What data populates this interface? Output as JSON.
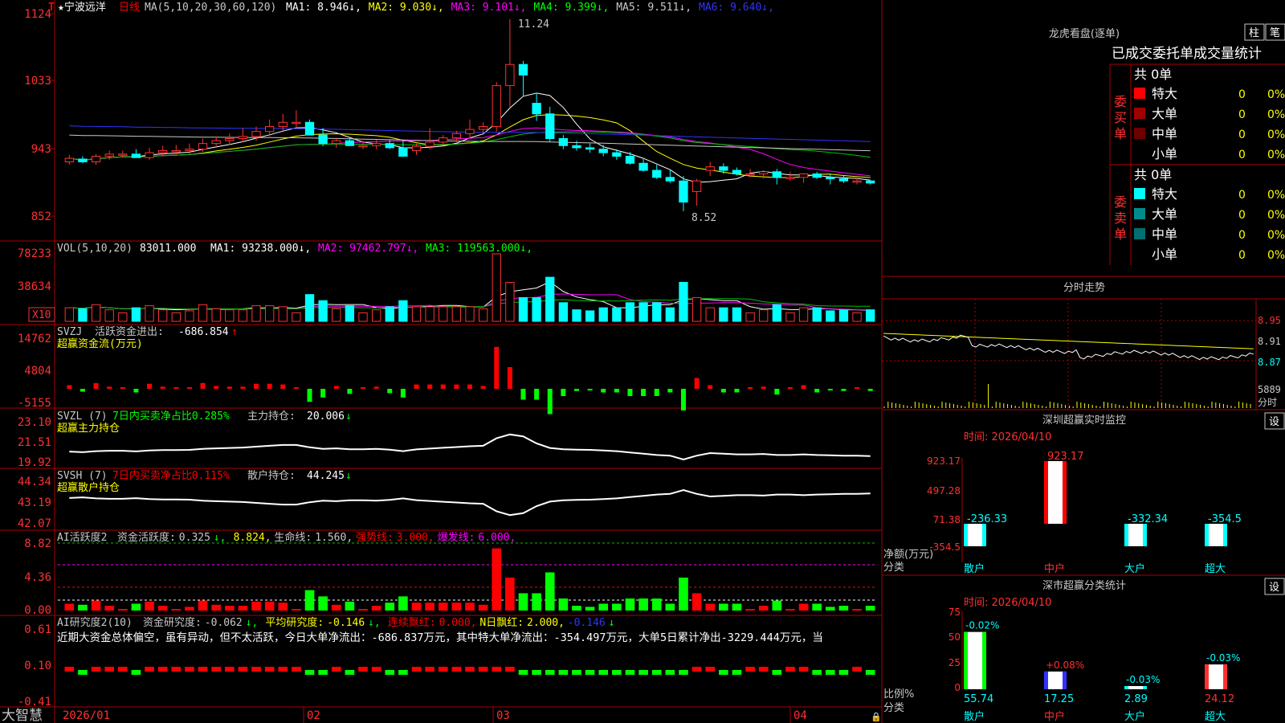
{
  "header": {
    "stock_name": "★宁波远洋",
    "period": "日线",
    "ma_label": "MA(5,10,20,30,60,120)",
    "ma_values": [
      {
        "label": "MA1:",
        "value": "8.946",
        "arrow": "↓",
        "color": "#ffffff"
      },
      {
        "label": "MA2:",
        "value": "9.030",
        "arrow": "↓",
        "color": "#ffff00"
      },
      {
        "label": "MA3:",
        "value": "9.101",
        "arrow": "↓",
        "color": "#ff00ff"
      },
      {
        "label": "MA4:",
        "value": "9.399",
        "arrow": "↓",
        "color": "#00ff00"
      },
      {
        "label": "MA5:",
        "value": "9.511",
        "arrow": "↓",
        "color": "#c8c8c8"
      },
      {
        "label": "MA6:",
        "value": "9.640",
        "arrow": "↓",
        "color": "#3232ff"
      }
    ],
    "high_marker": "11.24",
    "low_marker": "8.52",
    "top_marker": "T"
  },
  "price_axis": [
    "1124",
    "1033",
    "943",
    "852"
  ],
  "vol_panel": {
    "title": "VOL(5,10,20)",
    "value": "83011.000",
    "items": [
      {
        "label": "MA1:",
        "value": "93238.000",
        "arrow": "↓",
        "color": "#ffffff"
      },
      {
        "label": "MA2:",
        "value": "97462.797",
        "arrow": "↓",
        "color": "#ff00ff"
      },
      {
        "label": "MA3:",
        "value": "119563.000",
        "arrow": "↓",
        "color": "#00ff00"
      }
    ],
    "axis": [
      "78233",
      "38634"
    ],
    "unit_badge": "X10"
  },
  "svzj_panel": {
    "title": "SVZJ",
    "label": "活跃资金进出:",
    "value": "-686.854",
    "arrow": "↑",
    "subtitle": "超赢资金流(万元)",
    "axis": [
      "14762",
      "4804",
      "-5155"
    ]
  },
  "svzl_panel": {
    "title": "SVZL (7)",
    "label": "7日内买卖净占比0.285%",
    "label2": "主力持仓:",
    "value": "20.006",
    "arrow": "↓",
    "subtitle": "超赢主力持仓",
    "axis": [
      "23.10",
      "21.51",
      "19.92"
    ]
  },
  "svsh_panel": {
    "title": "SVSH (7)",
    "label": "7日内买卖净占比0.115%",
    "label2": "散户持仓:",
    "value": "44.245",
    "arrow": "↓",
    "subtitle": "超赢散户持仓",
    "axis": [
      "44.34",
      "43.19",
      "42.07"
    ]
  },
  "ai_active_panel": {
    "title": "AI活跃度2",
    "items": [
      {
        "text": "资金活跃度:",
        "color": "#c8c8c8"
      },
      {
        "text": "0.325",
        "color": "#c8c8c8"
      },
      {
        "text": "↓,",
        "color": "#00ff00"
      },
      {
        "text": "8.824,",
        "color": "#ffff00"
      },
      {
        "text": "生命线:",
        "color": "#c8c8c8"
      },
      {
        "text": "1.560,",
        "color": "#c8c8c8"
      },
      {
        "text": "强势线:",
        "color": "#ff0000"
      },
      {
        "text": "3.000,",
        "color": "#ff0000"
      },
      {
        "text": "爆发线:",
        "color": "#ff00ff"
      },
      {
        "text": "6.000,",
        "color": "#ff00ff"
      }
    ],
    "axis": [
      "8.82",
      "4.36",
      "0.00"
    ]
  },
  "ai_research_panel": {
    "title": "AI研究度2(10)",
    "items": [
      {
        "text": "资金研究度:",
        "color": "#c8c8c8"
      },
      {
        "text": "-0.062",
        "color": "#c8c8c8"
      },
      {
        "text": "↓,",
        "color": "#00ff00"
      },
      {
        "text": "平均研究度:",
        "color": "#ffff00"
      },
      {
        "text": "-0.146",
        "color": "#ffff00"
      },
      {
        "text": "↓,",
        "color": "#00ff00"
      },
      {
        "text": "连续飘红:",
        "color": "#ff0000"
      },
      {
        "text": "0.000,",
        "color": "#ff0000"
      },
      {
        "text": "N日飘红:",
        "color": "#ffff00"
      },
      {
        "text": "2.000,",
        "color": "#ffff00"
      },
      {
        "text": "-0.146",
        "color": "#3232ff"
      },
      {
        "text": "↓",
        "color": "#00ff00"
      }
    ],
    "summary": "近期大资金总体偏空，虽有异动，但不太活跃，今日大单净流出：-686.837万元，其中特大单净流出：-354.497万元，大单5日累计净出-3229.444万元，当",
    "axis": [
      "0.61",
      "0.10",
      "-0.41"
    ]
  },
  "date_axis": [
    "2026/01",
    "02",
    "03",
    "04"
  ],
  "brand": "大智慧",
  "right_panel": {
    "lhb_title": "龙虎看盘(逐单)",
    "btn_bar": "柱",
    "btn_pen": "笔",
    "table_header": "已成交委托单成交量统计",
    "buy_group": {
      "side_label": "委买单",
      "total": "共 0单",
      "rows": [
        {
          "label": "特大",
          "count": "0",
          "pct": "0%",
          "color": "#ff0000"
        },
        {
          "label": "大单",
          "count": "0",
          "pct": "0%",
          "color": "#a00000"
        },
        {
          "label": "中单",
          "count": "0",
          "pct": "0%",
          "color": "#6e0000"
        },
        {
          "label": "小单",
          "count": "0",
          "pct": "0%",
          "color": ""
        }
      ]
    },
    "sell_group": {
      "side_label": "委卖单",
      "total": "共 0单",
      "rows": [
        {
          "label": "特大",
          "count": "0",
          "pct": "0%",
          "color": "#00ffff"
        },
        {
          "label": "大单",
          "count": "0",
          "pct": "0%",
          "color": "#008c8c"
        },
        {
          "label": "中单",
          "count": "0",
          "pct": "0%",
          "color": "#007070"
        },
        {
          "label": "小单",
          "count": "0",
          "pct": "0%",
          "color": ""
        }
      ]
    },
    "timeshare_title": "分时走势",
    "timeshare_axis": [
      "8.95",
      "8.91",
      "8.87"
    ],
    "timeshare_vol": "5889",
    "timeshare_vol_label": "分时",
    "monitor_title": "深圳超赢实时监控",
    "monitor_btn": "设",
    "monitor_time": "时间: 2026/04/10",
    "monitor_axis": [
      "923.17",
      "497.28",
      "71.38",
      "-354.5"
    ],
    "monitor_ylabel": "净额(万元)",
    "monitor_xlabel": "分类",
    "classify_title": "深市超赢分类统计",
    "classify_btn": "设",
    "classify_time": "时间: 2026/04/10",
    "classify_axis": [
      "75",
      "50",
      "25",
      "0"
    ],
    "classify_ylabel": "比例%",
    "classify_xlabel": "分类"
  },
  "chart_data": [
    {
      "type": "candlestick",
      "title": "宁波远洋 日线",
      "ylim": [
        8.52,
        11.24
      ],
      "x": [
        "2026/01",
        "02",
        "03",
        "04"
      ],
      "open": [
        9.22,
        9.26,
        9.22,
        9.3,
        9.33,
        9.33,
        9.28,
        9.35,
        9.38,
        9.38,
        9.4,
        9.48,
        9.52,
        9.55,
        9.58,
        9.65,
        9.72,
        9.78,
        9.78,
        9.6,
        9.48,
        9.52,
        9.45,
        9.45,
        9.48,
        9.42,
        9.38,
        9.44,
        9.5,
        9.56,
        9.62,
        9.68,
        9.72,
        10.3,
        10.6,
        10.05,
        9.9,
        9.55,
        9.45,
        9.42,
        9.4,
        9.35,
        9.3,
        9.2,
        9.1,
        9.0,
        8.95,
        8.8,
        9.1,
        9.15,
        9.1,
        9.05,
        9.05,
        9.08,
        9.0,
        9.0,
        9.05,
        9.0,
        8.98,
        8.95,
        8.95
      ],
      "high": [
        9.32,
        9.3,
        9.33,
        9.38,
        9.38,
        9.4,
        9.42,
        9.45,
        9.46,
        9.48,
        9.55,
        9.58,
        9.62,
        9.7,
        9.72,
        9.82,
        9.9,
        9.95,
        9.82,
        9.7,
        9.56,
        9.57,
        9.52,
        9.53,
        9.54,
        9.52,
        9.48,
        9.7,
        9.6,
        9.66,
        9.82,
        9.78,
        10.35,
        11.24,
        10.65,
        10.2,
        10.0,
        9.6,
        9.52,
        9.48,
        9.46,
        9.4,
        9.36,
        9.26,
        9.18,
        9.1,
        9.02,
        8.98,
        9.22,
        9.2,
        9.14,
        9.12,
        9.1,
        9.12,
        9.08,
        9.06,
        9.08,
        9.04,
        9.02,
        8.99,
        8.96
      ],
      "low": [
        9.18,
        9.2,
        9.18,
        9.25,
        9.28,
        9.28,
        9.25,
        9.3,
        9.32,
        9.33,
        9.36,
        9.42,
        9.46,
        9.5,
        9.52,
        9.58,
        9.66,
        9.7,
        9.6,
        9.44,
        9.42,
        9.45,
        9.4,
        9.4,
        9.4,
        9.38,
        9.32,
        9.4,
        9.45,
        9.5,
        9.55,
        9.62,
        9.65,
        10.0,
        10.15,
        9.8,
        9.5,
        9.4,
        9.38,
        9.35,
        9.3,
        9.25,
        9.18,
        9.08,
        8.98,
        8.92,
        8.52,
        8.6,
        9.02,
        9.05,
        9.03,
        9.0,
        8.98,
        8.9,
        8.95,
        8.92,
        8.98,
        8.9,
        8.92,
        8.9,
        8.9
      ],
      "close": [
        9.27,
        9.22,
        9.3,
        9.33,
        9.33,
        9.28,
        9.35,
        9.38,
        9.38,
        9.4,
        9.48,
        9.52,
        9.55,
        9.58,
        9.65,
        9.72,
        9.78,
        9.78,
        9.6,
        9.48,
        9.52,
        9.45,
        9.45,
        9.48,
        9.42,
        9.3,
        9.44,
        9.5,
        9.56,
        9.62,
        9.68,
        9.72,
        10.3,
        10.6,
        10.45,
        9.9,
        9.55,
        9.45,
        9.42,
        9.4,
        9.35,
        9.3,
        9.2,
        9.1,
        9.0,
        8.95,
        8.65,
        8.95,
        9.15,
        9.1,
        9.05,
        9.05,
        9.08,
        9.0,
        9.0,
        9.05,
        9.0,
        8.98,
        8.95,
        8.95,
        8.92
      ]
    },
    {
      "type": "bar",
      "title": "深圳超赢实时监控",
      "categories": [
        "散户",
        "中户",
        "大户",
        "超大"
      ],
      "values": [
        -236.33,
        923.17,
        -332.34,
        -354.5
      ],
      "ylim": [
        -354.5,
        923.17
      ],
      "ylabel": "净额(万元)",
      "xlabel": "分类"
    },
    {
      "type": "bar",
      "title": "深市超赢分类统计",
      "categories": [
        "散户",
        "中户",
        "大户",
        "超大"
      ],
      "values": [
        55.74,
        17.25,
        2.89,
        24.12
      ],
      "changes": [
        "-0.02%",
        "+0.08%",
        "-0.03%",
        "-0.03%"
      ],
      "ylim": [
        0,
        75
      ],
      "ylabel": "比例%",
      "xlabel": "分类"
    }
  ]
}
